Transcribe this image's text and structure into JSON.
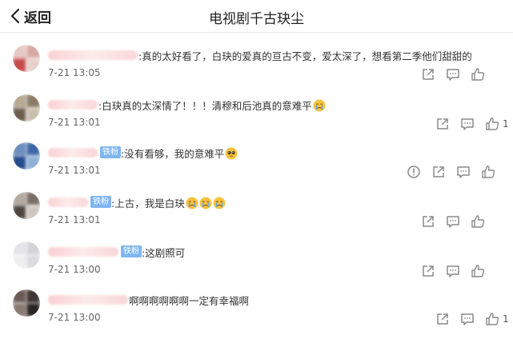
{
  "header": {
    "back_label": "返回",
    "title": "电视剧千古玦尘"
  },
  "comments": [
    {
      "text": ":真的太好看了，白玦的爱真的亘古不变，爱太深了，想看第二季他们甜甜的",
      "time": "7-21 13:05",
      "likes": "",
      "badge": "",
      "emojis": []
    },
    {
      "text": ":白玦真的太深情了！！！清穆和后池真的意难平",
      "time": "7-21 13:01",
      "likes": "1",
      "badge": "",
      "emojis": [
        "crying-face"
      ]
    },
    {
      "text": ":没有看够，我的意难平",
      "time": "7-21 13:01",
      "likes": "",
      "badge": "铁粉",
      "emojis": [
        "pleading-face"
      ]
    },
    {
      "text": ":上古，我是白玦",
      "time": "7-21 13:01",
      "likes": "",
      "badge": "铁粉",
      "emojis": [
        "crying-face",
        "crying-face",
        "crying-face"
      ]
    },
    {
      "text": ":这剧照可",
      "time": "7-21 13:00",
      "likes": "",
      "badge": "铁粉",
      "emojis": []
    },
    {
      "text": "啊啊啊啊啊啊一定有幸福啊",
      "time": "7-21 13:00",
      "likes": "1",
      "badge": "",
      "emojis": []
    }
  ],
  "colors": {
    "badge": "#7fb6f0",
    "icon": "#8a8a8a",
    "text": "#333333",
    "time": "#666666"
  },
  "icons": {
    "back": "chevron-left-icon",
    "share": "share-icon",
    "comment": "comment-icon",
    "like": "like-icon",
    "report": "report-icon"
  }
}
